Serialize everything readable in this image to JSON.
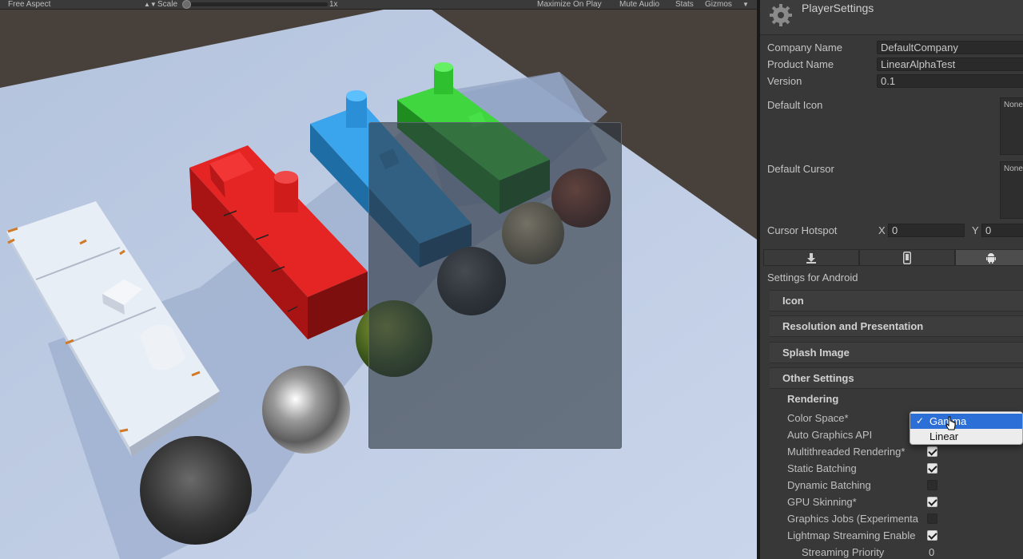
{
  "game_toolbar": {
    "aspect": "Free Aspect",
    "scale_label": "Scale",
    "scale_value": "1x",
    "scale_level": 0.0,
    "maximize": "Maximize On Play",
    "mute": "Mute Audio",
    "stats": "Stats",
    "gizmos": "Gizmos"
  },
  "inspector": {
    "title": "PlayerSettings",
    "company_name_label": "Company Name",
    "company_name_value": "DefaultCompany",
    "product_name_label": "Product Name",
    "product_name_value": "LinearAlphaTest",
    "version_label": "Version",
    "version_value": "0.1",
    "default_icon_label": "Default Icon",
    "default_icon_value": "None",
    "default_cursor_label": "Default Cursor",
    "default_cursor_value": "None",
    "cursor_hotspot_label": "Cursor Hotspot",
    "hotspot_x_label": "X",
    "hotspot_x_value": "0",
    "hotspot_y_label": "Y",
    "hotspot_y_value": "0",
    "platform_tabs": [
      "download-icon",
      "phone-icon",
      "android-icon"
    ],
    "active_platform": "android",
    "settings_for": "Settings for Android",
    "sections": {
      "icon": "Icon",
      "resolution": "Resolution and Presentation",
      "splash": "Splash Image",
      "other": "Other Settings"
    },
    "rendering_header": "Rendering",
    "color_space_label": "Color Space*",
    "auto_graphics_label": "Auto Graphics API",
    "multithreaded_label": "Multithreaded Rendering*",
    "multithreaded_checked": true,
    "static_batching_label": "Static Batching",
    "static_batching_checked": true,
    "dynamic_batching_label": "Dynamic Batching",
    "dynamic_batching_checked": false,
    "gpu_skinning_label": "GPU Skinning*",
    "gpu_skinning_checked": true,
    "graphics_jobs_label": "Graphics Jobs (Experimenta",
    "graphics_jobs_checked": false,
    "lightmap_streaming_label": "Lightmap Streaming Enable",
    "lightmap_streaming_checked": true,
    "streaming_priority_label": "Streaming Priority",
    "streaming_priority_value": "0"
  },
  "color_space_popup": {
    "options": [
      "Gamma",
      "Linear"
    ],
    "selected": "Gamma",
    "check_mark": "✓"
  },
  "colors": {
    "red_block": "#d41b1b",
    "blue_block": "#2a8fd6",
    "green_block": "#2fc02f",
    "selection_blue": "#2c6fd6"
  }
}
